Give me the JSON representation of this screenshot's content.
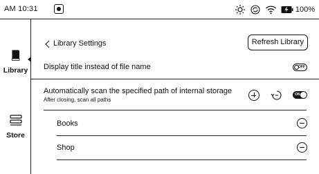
{
  "status_bar": {
    "time": "AM 10:31",
    "battery": "100%",
    "icons": [
      "app-indicator-icon",
      "brightness-icon",
      "sync-icon",
      "wifi-icon",
      "battery-icon"
    ]
  },
  "sidebar": {
    "items": [
      {
        "label": "Library",
        "icon": "book-icon",
        "active": true
      },
      {
        "label": "Store",
        "icon": "store-icon",
        "active": false
      }
    ]
  },
  "header": {
    "title": "Library Settings",
    "refresh_label": "Refresh Library"
  },
  "settings": {
    "display_title": {
      "label": "Display title instead of file name",
      "toggle": "OFF"
    },
    "auto_scan": {
      "label": "Automatically scan the specified path of internal storage",
      "sublabel": "After closing, scan all paths",
      "toggle": "ON"
    },
    "paths": [
      {
        "name": "Books"
      },
      {
        "name": "Shop"
      }
    ]
  }
}
